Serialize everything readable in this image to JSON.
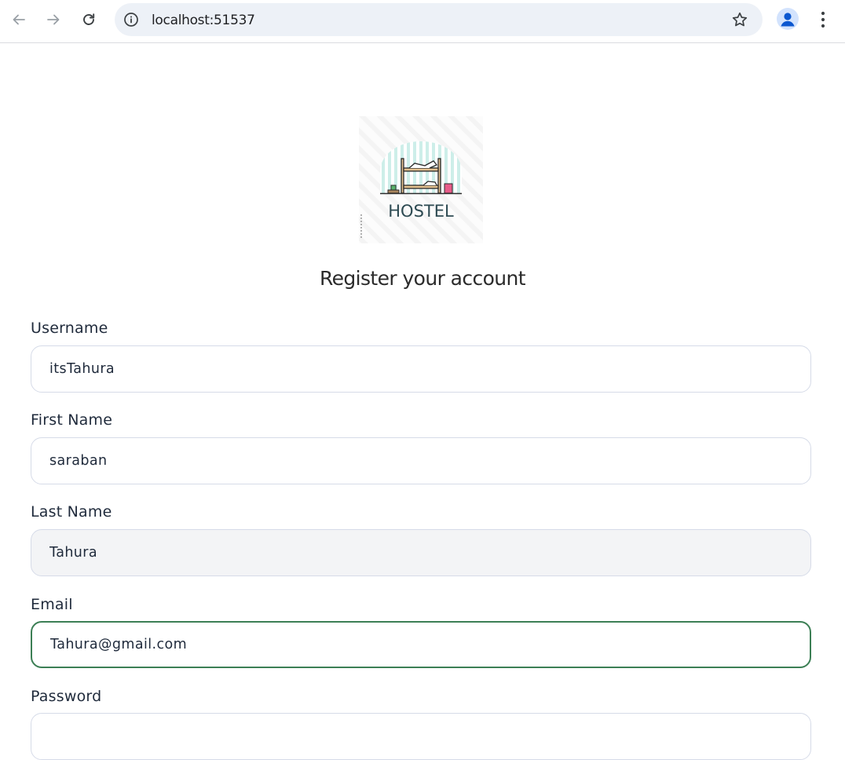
{
  "browser": {
    "url": "localhost:51537"
  },
  "logo": {
    "text": "HOSTEL"
  },
  "page": {
    "title": "Register your account"
  },
  "form": {
    "username": {
      "label": "Username",
      "value": "itsTahura"
    },
    "first_name": {
      "label": "First Name",
      "value": "saraban"
    },
    "last_name": {
      "label": "Last Name",
      "value": "Tahura"
    },
    "email": {
      "label": "Email",
      "value": "Tahura@gmail.com"
    },
    "password": {
      "label": "Password",
      "value": ""
    }
  },
  "colors": {
    "accent_focus": "#3c7f55",
    "input_border": "#d6dbe8",
    "label_text": "#1f2a3b"
  },
  "icons": [
    "back-arrow-icon",
    "forward-arrow-icon",
    "reload-icon",
    "site-info-icon",
    "bookmark-star-icon",
    "profile-icon",
    "more-menu-icon"
  ]
}
